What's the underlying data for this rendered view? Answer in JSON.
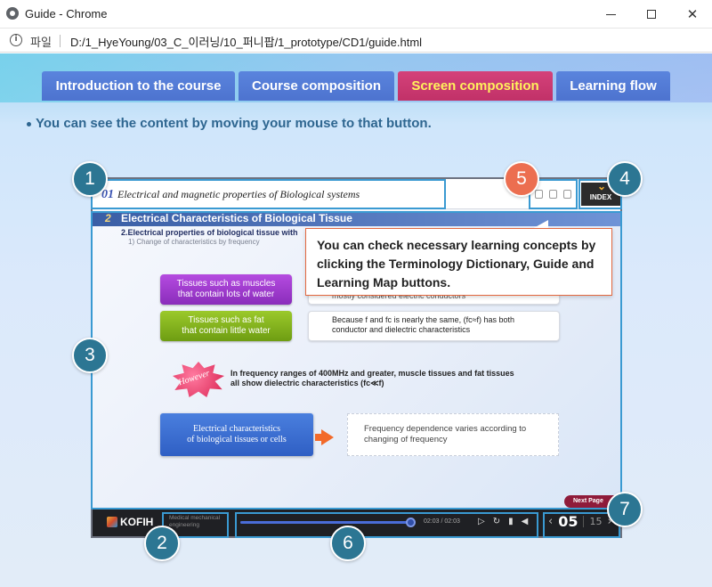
{
  "window": {
    "title": "Guide - Chrome",
    "protocol_label": "파일",
    "url": "D:/1_HyeYoung/03_C_이러닝/10_퍼니팝/1_prototype/CD1/guide.html"
  },
  "tabs": [
    {
      "label": "Introduction to the course",
      "active": false
    },
    {
      "label": "Course composition",
      "active": false
    },
    {
      "label": "Screen composition",
      "active": true
    },
    {
      "label": "Learning flow",
      "active": false
    }
  ],
  "instruction": "You can see the content by moving your mouse to that button.",
  "screen": {
    "header": {
      "number": "01",
      "title": "Electrical and magnetic properties of Biological systems",
      "index_label": "INDEX"
    },
    "section": {
      "number": "2",
      "title": "Electrical Characteristics of Biological Tissue",
      "subtitle": "2.Electrical properties of biological tissue with",
      "subsubtitle": "1) Change of characteristics by frequency"
    },
    "rows": [
      {
        "label_line1": "Tissues such as muscles",
        "label_line2": "that contain lots of water",
        "desc_line1": "mostly considered electric conductors",
        "desc_line2": ""
      },
      {
        "label_line1": "Tissues such as fat",
        "label_line2": "that contain little water",
        "desc_line1": "Because f and fc is nearly the same, (fc≈f) has both",
        "desc_line2": "conductor and dielectric characteristics"
      }
    ],
    "however_label": "However",
    "frequency_note_line1": "In frequency ranges of 400MHz and greater, muscle tissues and fat tissues",
    "frequency_note_line2": "all show dielectric characteristics (fc≪f)",
    "electrical_box_line1": "Electrical characteristics",
    "electrical_box_line2": "of biological tissues or cells",
    "frequency_box_line1": "Frequency dependence varies according to",
    "frequency_box_line2": "changing of frequency",
    "next_page_label": "Next Page",
    "controls": {
      "logo": "KOFIH",
      "course_line1": "Medical mechanical",
      "course_line2": "engineering",
      "time": "02:03 / 02:03",
      "progress": 1.0,
      "current_page": "05",
      "total_pages": "15"
    }
  },
  "tooltip": "You can check necessary learning concepts by clicking the Terminology Dictionary, Guide and Learning Map buttons.",
  "badges": [
    "1",
    "2",
    "3",
    "4",
    "5",
    "6",
    "7"
  ],
  "colors": {
    "tab_blue": "#4f76d2",
    "tab_active": "#c9386f",
    "tab_active_text": "#fff35c",
    "badge_teal": "#2c7693",
    "badge_orange": "#ec6e50",
    "highlight": "#3a9ad2"
  }
}
